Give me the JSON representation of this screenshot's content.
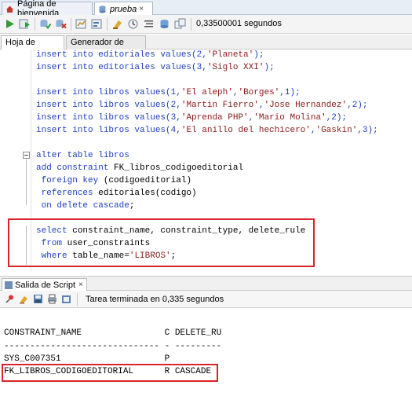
{
  "doc_tabs": [
    {
      "label": "Página de bienvenida",
      "close": "×"
    },
    {
      "label": "prueba",
      "close": "×"
    }
  ],
  "toolbar": {
    "elapsed": "0,33500001 segundos"
  },
  "worksheet_tabs": [
    {
      "label": "Hoja de Trabajo"
    },
    {
      "label": "Generador de Consultas"
    }
  ],
  "editor": {
    "lines": [
      {
        "pre": "insert into ",
        "kw": "",
        "text": "editoriales values(2,",
        "str": "'Planeta'",
        "end": ");"
      },
      {
        "pre": "insert into ",
        "kw": "",
        "text": "editoriales values(3,",
        "str": "'Siglo XXI'",
        "end": ");"
      },
      {
        "raw": "insert into libros values(1,'El aleph','Borges',1);"
      },
      {
        "raw": "insert into libros values(2,'Martin Fierro','Jose Hernandez',2);"
      },
      {
        "raw": "insert into libros values(3,'Aprenda PHP','Mario Molina',2);"
      },
      {
        "raw": "insert into libros values(4,'El anillo del hechicero','Gaskin',3);"
      },
      {
        "raw": "alter table libros"
      },
      {
        "raw": "add constraint FK_libros_codigoeditorial"
      },
      {
        "raw": " foreign key (codigoeditorial)"
      },
      {
        "raw": " references editoriales(codigo)"
      },
      {
        "raw": " on delete cascade;"
      },
      {
        "raw": "select constraint_name, constraint_type, delete_rule"
      },
      {
        "raw": " from user_constraints"
      },
      {
        "raw": " where table_name='LIBROS';"
      }
    ]
  },
  "script_output": {
    "tab_label": "Salida de Script",
    "close": "×",
    "status": "Tarea terminada en 0,335 segundos",
    "lines": [
      "CONSTRAINT_NAME                C DELETE_RU",
      "------------------------------ - ---------",
      "SYS_C007351                    P",
      "FK_LIBROS_CODIGOEDITORIAL      R CASCADE"
    ]
  },
  "colors": {
    "keyword": "#1f3fbf",
    "string": "#8a1a1a",
    "highlight_box": "#d9232a"
  }
}
